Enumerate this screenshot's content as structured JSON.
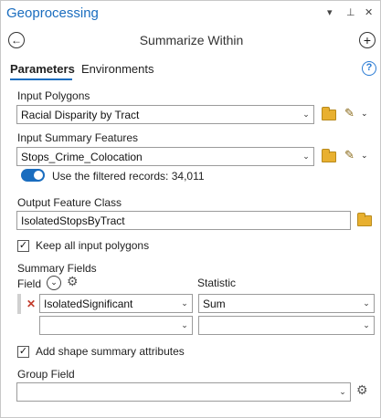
{
  "header": {
    "title": "Geoprocessing",
    "pin_glyph": "▾ ⊥ ✕"
  },
  "tool": {
    "title": "Summarize Within"
  },
  "tabs": [
    {
      "label": "Parameters"
    },
    {
      "label": "Environments"
    }
  ],
  "help_label": "?",
  "input_polygons": {
    "label": "Input Polygons",
    "value": "Racial Disparity by Tract"
  },
  "input_summary": {
    "label": "Input Summary Features",
    "value": "Stops_Crime_Colocation",
    "filter_label": "Use the filtered records: 34,011"
  },
  "output": {
    "label": "Output Feature Class",
    "value": "IsolatedStopsByTract"
  },
  "keep_all": {
    "label": "Keep all input polygons",
    "checked": true
  },
  "summary_fields": {
    "label": "Summary Fields",
    "field_label": "Field",
    "statistic_label": "Statistic",
    "rows": [
      {
        "field": "IsolatedSignificant",
        "statistic": "Sum"
      },
      {
        "field": "",
        "statistic": ""
      }
    ]
  },
  "shape_summary": {
    "label": "Add shape summary  attributes",
    "checked": true
  },
  "group_field": {
    "label": "Group Field",
    "value": ""
  },
  "colors": {
    "accent": "#1a6dbf",
    "folder": "#e8b030",
    "remove": "#c23a2a"
  }
}
